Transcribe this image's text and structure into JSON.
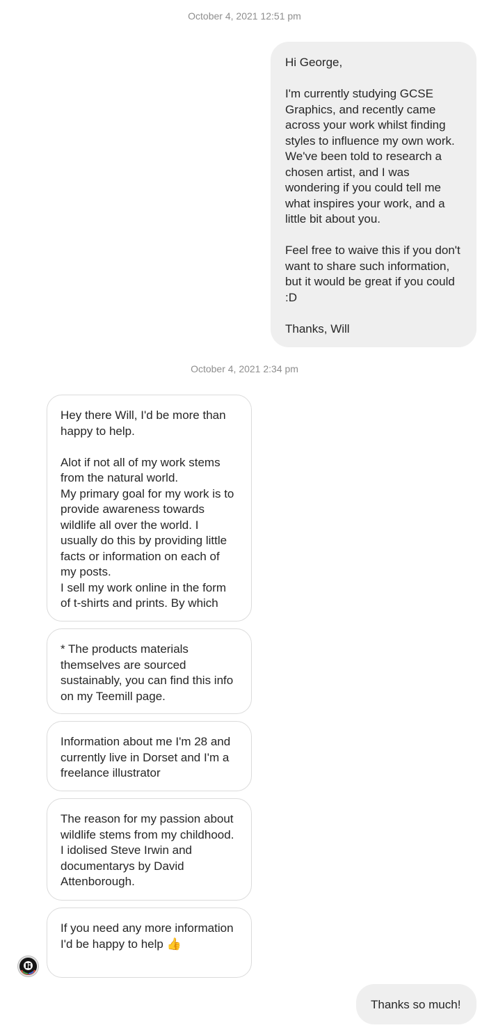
{
  "thread": {
    "timestamp_1": "October 4, 2021 12:51 pm",
    "timestamp_2": "October 4, 2021 2:34 pm",
    "messages": [
      {
        "direction": "outgoing",
        "text": "Hi George,\n\nI'm currently studying GCSE Graphics, and recently came across your work whilst finding styles to influence my own work. We've been told to research a chosen artist, and I was wondering if you could tell me what inspires your work, and a little bit about you.\n\nFeel free to waive this if you don't want to share such information, but it would be great if you could :D\n\nThanks, Will"
      },
      {
        "direction": "incoming",
        "text": "Hey there Will, I'd be more than happy to help.\n\nAlot if not all of my work stems from the natural world.\nMy primary goal for my work is to provide awareness towards wildlife all over the world. I usually do this by providing little facts or information on each of my posts.\nI sell my work online in the form of t-shirts and prints. By which"
      },
      {
        "direction": "incoming",
        "text": "* The products materials themselves are sourced sustainably, you can find this info on my Teemill page."
      },
      {
        "direction": "incoming",
        "text": "Information about me I'm 28 and currently live in Dorset and I'm a freelance illustrator"
      },
      {
        "direction": "incoming",
        "text": "The reason for my passion about wildlife stems from my childhood. I idolised Steve Irwin and documentarys by David Attenborough."
      },
      {
        "direction": "incoming",
        "text": "If you need any more information I'd be happy to help ",
        "emoji": "👍"
      },
      {
        "direction": "outgoing",
        "text": "Thanks so much!"
      }
    ]
  },
  "icons": {
    "sender_avatar": "sender-avatar-logo"
  }
}
